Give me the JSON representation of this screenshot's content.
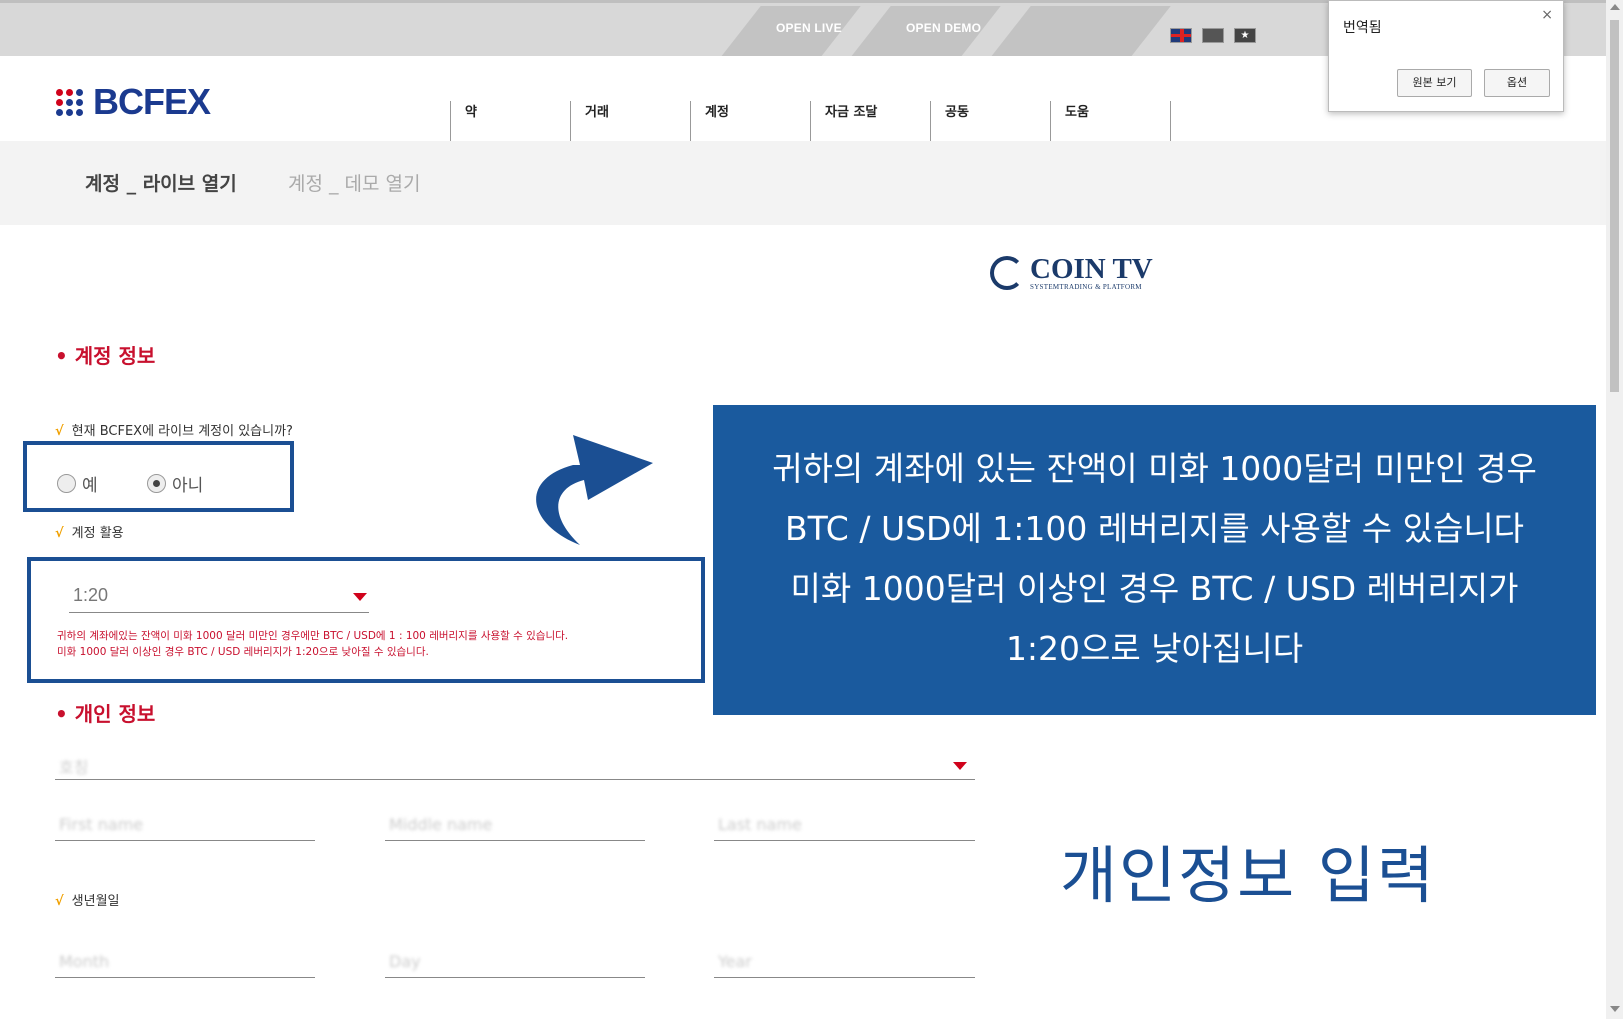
{
  "topbar": {
    "open_live": "OPEN LIVE",
    "open_demo": "OPEN DEMO",
    "flag_vn_symbol": "★"
  },
  "header": {
    "logo_text": "BCFEX",
    "nav": [
      "약",
      "거래",
      "계정",
      "자금 조달",
      "공동",
      "도움"
    ]
  },
  "subheader": {
    "active": "계정 _ 라이브 열기",
    "inactive": "계정 _ 데모 열기"
  },
  "cointv": {
    "title": "COIN TV",
    "subtitle": "SYSTEMTRADING & PLATFORM"
  },
  "account_info": {
    "heading": "• 계정 정보",
    "question": "현재 BCFEX에 라이브 계정이 있습니까?",
    "options": [
      "예",
      "아니"
    ],
    "selected": "아니",
    "leverage_label": "계정 활용",
    "leverage_value": "1:20",
    "leverage_note_1": "귀하의 계좌에있는 잔액이 미화 1000 달러 미만인 경우에만 BTC / USD에 1 : 100 레버리지를 사용할 수 있습니다.",
    "leverage_note_2": "미화 1000 달러 이상인 경우 BTC / USD 레버리지가 1:20으로 낮아질 수 있습니다."
  },
  "callout": {
    "line1": "귀하의 계좌에 있는 잔액이 미화 1000달러 미만인 경우",
    "line2": "BTC / USD에 1:100 레버리지를 사용할 수 있습니다",
    "line3": "미화 1000달러 이상인 경우 BTC / USD 레버리지가",
    "line4": "1:20으로 낮아집니다"
  },
  "personal_info": {
    "heading": "• 개인 정보",
    "title_placeholder": "호칭",
    "first_name_placeholder": "First name",
    "middle_name_placeholder": "Middle name",
    "last_name_placeholder": "Last name",
    "dob_label": "생년월일",
    "month_placeholder": "Month",
    "day_placeholder": "Day",
    "year_placeholder": "Year",
    "big_label": "개인정보 입력"
  },
  "translate_popup": {
    "title": "번역됨",
    "close": "×",
    "show_original": "원본 보기",
    "options": "옵션"
  },
  "colors": {
    "accent_red": "#c8102e",
    "brand_blue": "#1b3a8f",
    "callout_blue": "#1a5a9e",
    "highlight_border": "#1b4f93"
  }
}
